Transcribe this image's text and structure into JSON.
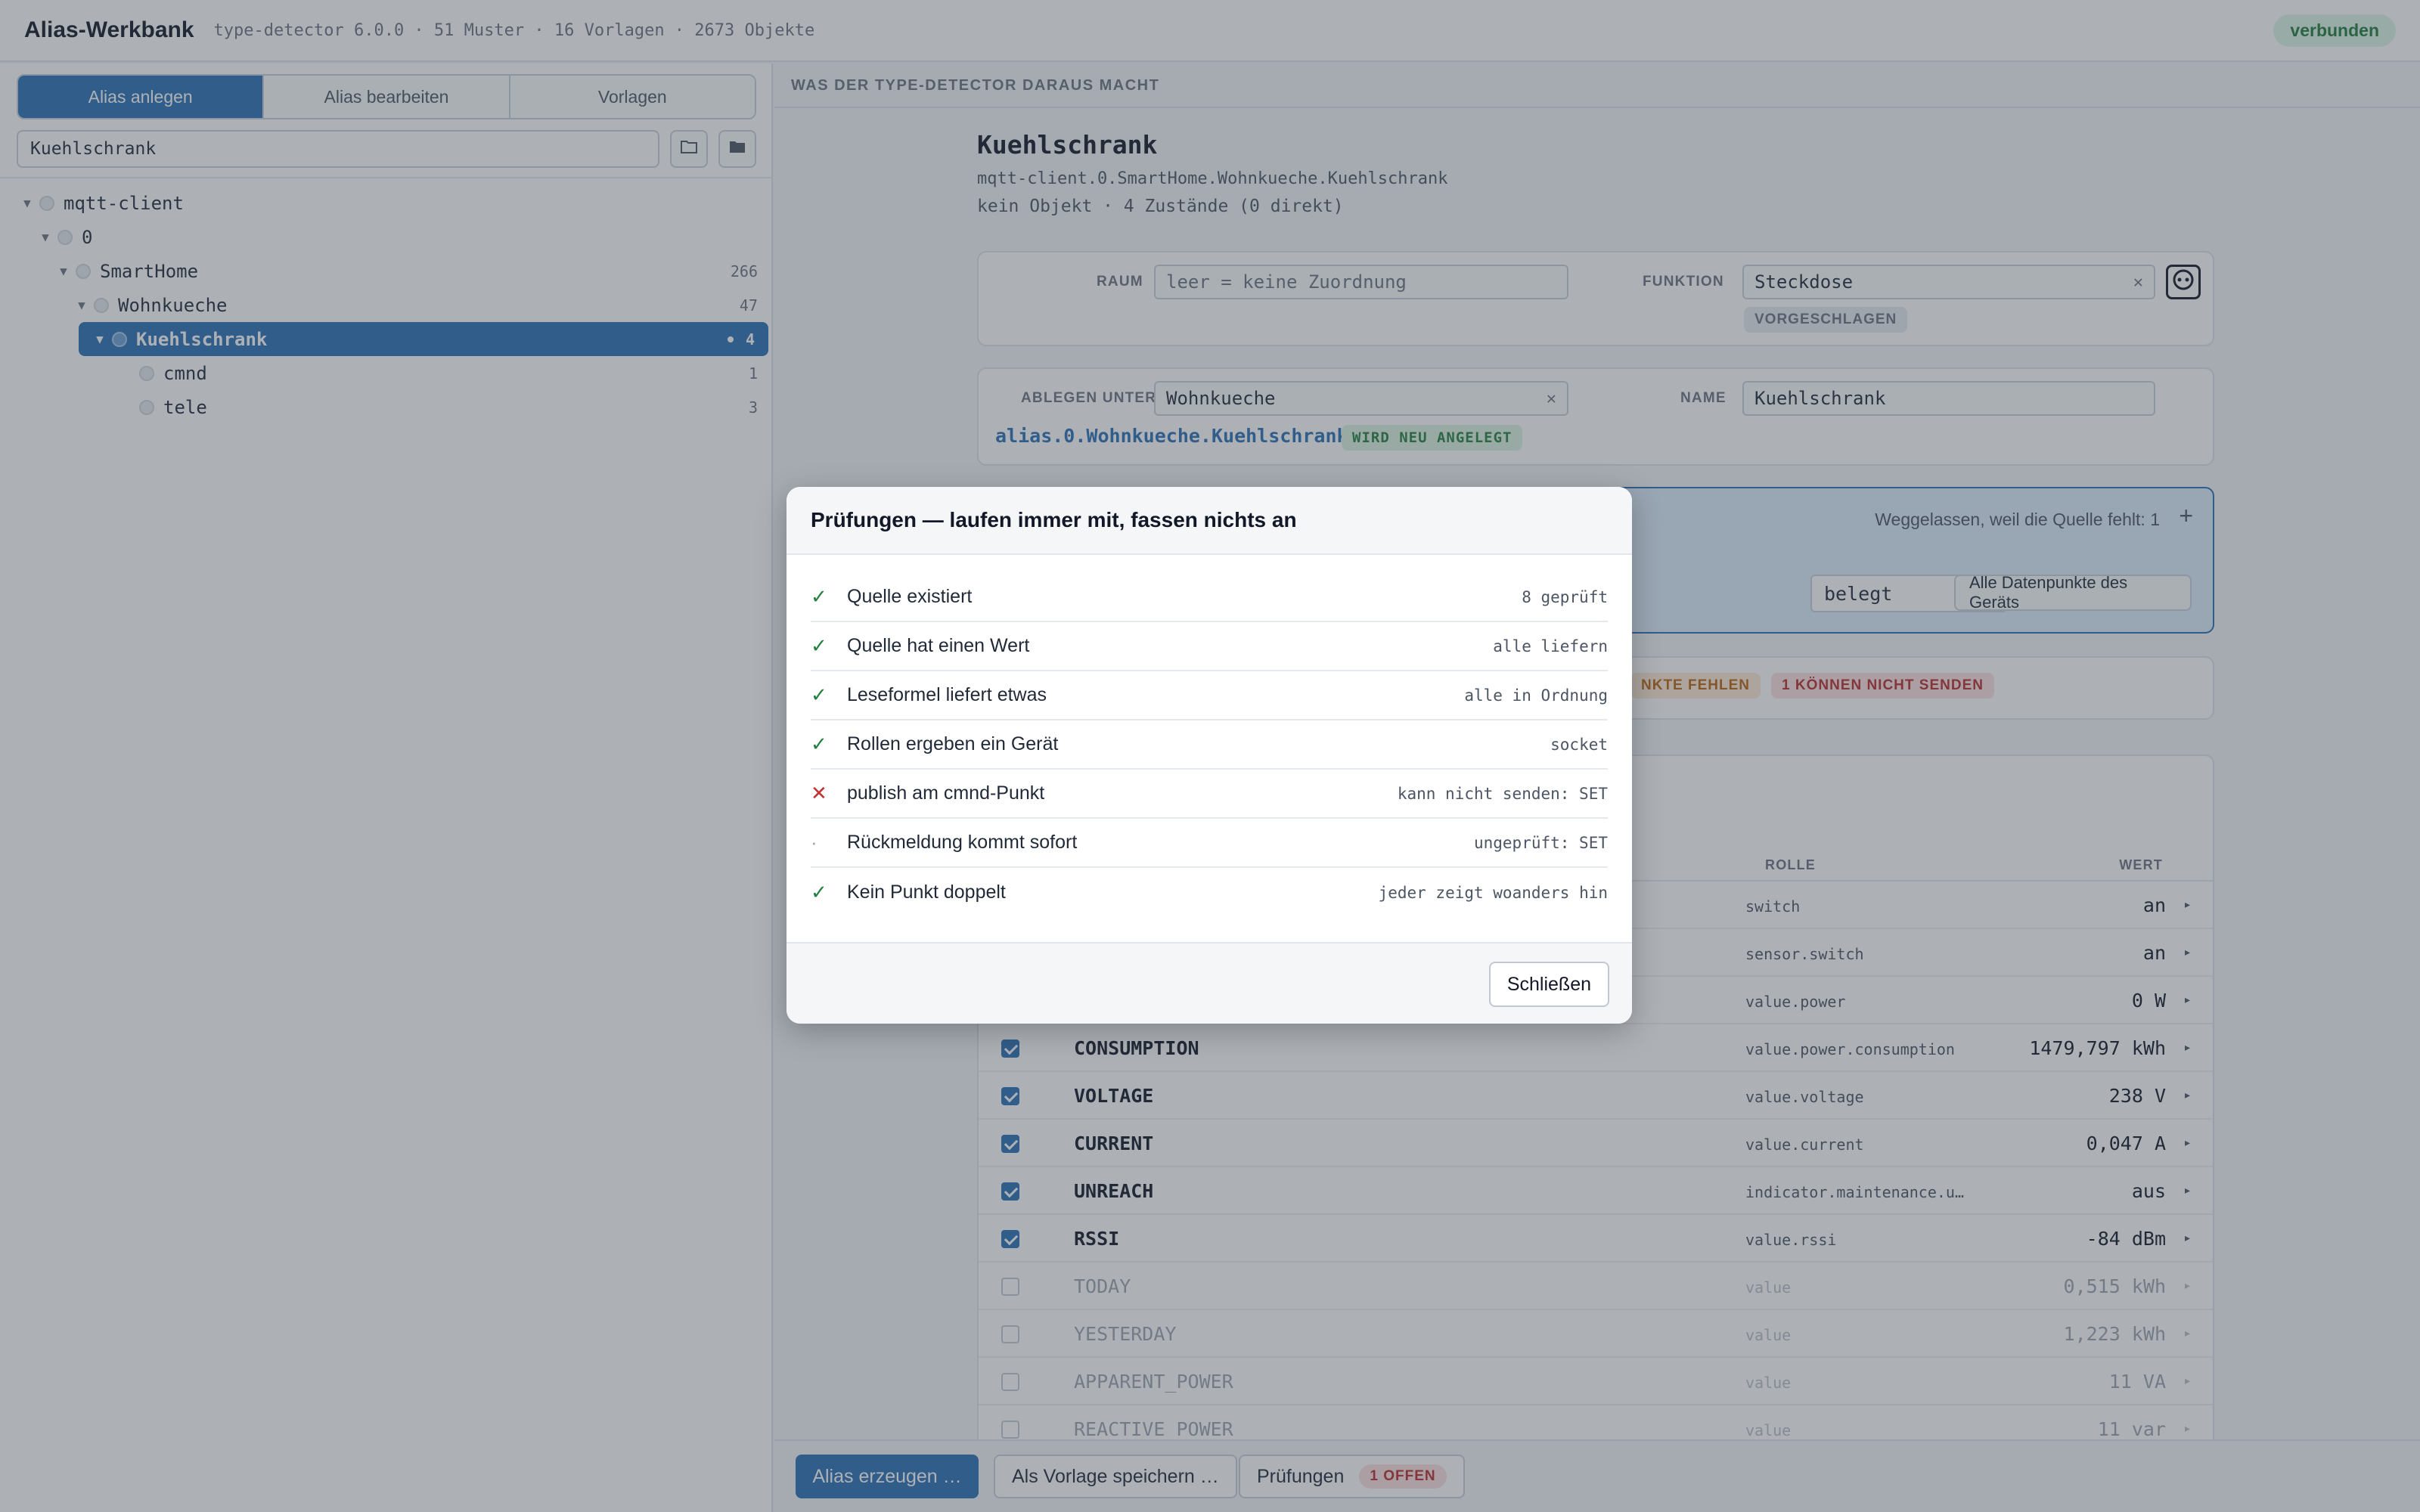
{
  "header": {
    "title": "Alias-Werkbank",
    "meta": "type-detector 6.0.0 · 51 Muster · 16 Vorlagen · 2673 Objekte",
    "status": "verbunden"
  },
  "left": {
    "tabs": [
      "Alias anlegen",
      "Alias bearbeiten",
      "Vorlagen"
    ],
    "search_value": "Kuehlschrank",
    "tree": [
      {
        "label": "mqtt-client",
        "count": ""
      },
      {
        "label": "0",
        "count": ""
      },
      {
        "label": "SmartHome",
        "count": "266"
      },
      {
        "label": "Wohnkueche",
        "count": "47"
      },
      {
        "label": "Kuehlschrank",
        "count": "4"
      },
      {
        "label": "cmnd",
        "count": "1"
      },
      {
        "label": "tele",
        "count": "3"
      }
    ]
  },
  "right": {
    "section_label": "WAS DER TYPE-DETECTOR DARAUS MACHT",
    "title": "Kuehlschrank",
    "path": "mqtt-client.0.SmartHome.Wohnkueche.Kuehlschrank",
    "info": "kein Objekt · 4 Zustände (0 direkt)",
    "raum_label": "RAUM",
    "raum_placeholder": "leer = keine Zuordnung",
    "funktion_label": "FUNKTION",
    "funktion_value": "Steckdose",
    "suggested": "VORGESCHLAGEN",
    "ablegen_label": "ABLEGEN UNTER",
    "ablegen_value": "Wohnkueche",
    "name_label": "NAME",
    "name_value": "Kuehlschrank",
    "alias_path": "alias.0.Wohnkueche.Kuehlschrank",
    "new_badge": "WIRD NEU ANGELEGT",
    "omitted": "Weggelassen, weil die Quelle fehlt: 1",
    "belegt": "belegt",
    "all_points": "Alle Datenpunkte des Geräts",
    "warn_missing": "NKTE FEHLEN",
    "warn_cannot_send": "1 KÖNNEN NICHT SENDEN",
    "col_role": "ROLLE",
    "col_value": "WERT",
    "rows": [
      {
        "name": "",
        "role": "switch",
        "value": "an",
        "checked": true
      },
      {
        "name": "",
        "role": "sensor.switch",
        "value": "an",
        "checked": true
      },
      {
        "name": "",
        "role": "value.power",
        "value": "0 W",
        "checked": true
      },
      {
        "name": "CONSUMPTION",
        "role": "value.power.consumption",
        "value": "1479,797 kWh",
        "checked": true
      },
      {
        "name": "VOLTAGE",
        "role": "value.voltage",
        "value": "238 V",
        "checked": true
      },
      {
        "name": "CURRENT",
        "role": "value.current",
        "value": "0,047 A",
        "checked": true
      },
      {
        "name": "UNREACH",
        "role": "indicator.maintenance.u…",
        "value": "aus",
        "checked": true
      },
      {
        "name": "RSSI",
        "role": "value.rssi",
        "value": "-84 dBm",
        "checked": true
      },
      {
        "name": "TODAY",
        "role": "value",
        "value": "0,515 kWh",
        "checked": false
      },
      {
        "name": "YESTERDAY",
        "role": "value",
        "value": "1,223 kWh",
        "checked": false
      },
      {
        "name": "APPARENT_POWER",
        "role": "value",
        "value": "11 VA",
        "checked": false
      },
      {
        "name": "REACTIVE_POWER",
        "role": "value",
        "value": "11 var",
        "checked": false
      }
    ]
  },
  "footer": {
    "create": "Alias erzeugen …",
    "save_template": "Als Vorlage speichern …",
    "checks": "Prüfungen",
    "checks_badge": "1 OFFEN"
  },
  "modal": {
    "title": "Prüfungen — laufen immer mit, fassen nichts an",
    "checks": [
      {
        "label": "Quelle existiert",
        "note": "8 geprüft",
        "status": "ok"
      },
      {
        "label": "Quelle hat einen Wert",
        "note": "alle liefern",
        "status": "ok"
      },
      {
        "label": "Leseformel liefert etwas",
        "note": "alle in Ordnung",
        "status": "ok"
      },
      {
        "label": "Rollen ergeben ein Gerät",
        "note": "socket",
        "status": "ok"
      },
      {
        "label": "publish am cmnd-Punkt",
        "note": "kann nicht senden: SET",
        "status": "fail"
      },
      {
        "label": "Rückmeldung kommt sofort",
        "note": "ungeprüft: SET",
        "status": "pending"
      },
      {
        "label": "Kein Punkt doppelt",
        "note": "jeder zeigt woanders hin",
        "status": "ok"
      }
    ],
    "close": "Schließen"
  },
  "icons": [
    "folder-open-icon",
    "folder-icon",
    "clear-icon",
    "plug-icon",
    "plus-icon",
    "caret-down-icon",
    "expand-arrow-icon",
    "check-icon",
    "cross-icon"
  ],
  "colors": {
    "accent": "#2a6fb4",
    "ok": "#23803f",
    "fail": "#c43030",
    "warn": "#b86510"
  }
}
